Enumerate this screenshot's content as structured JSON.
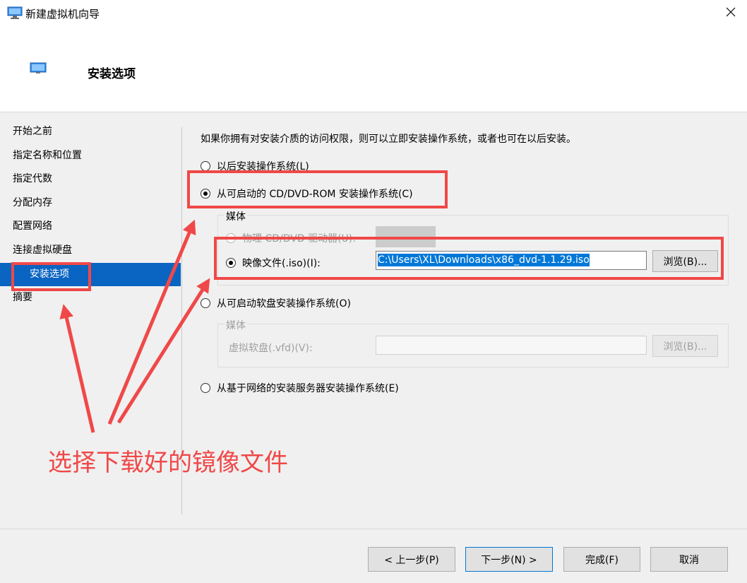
{
  "window": {
    "title": "新建虚拟机向导"
  },
  "header": {
    "title": "安装选项"
  },
  "sidebar": {
    "items": [
      {
        "label": "开始之前"
      },
      {
        "label": "指定名称和位置"
      },
      {
        "label": "指定代数"
      },
      {
        "label": "分配内存"
      },
      {
        "label": "配置网络"
      },
      {
        "label": "连接虚拟硬盘"
      },
      {
        "label": "安装选项"
      },
      {
        "label": "摘要"
      }
    ]
  },
  "main": {
    "intro": "如果你拥有对安装介质的访问权限，则可以立即安装操作系统，或者也可在以后安装。",
    "opt_later": "以后安装操作系统(L)",
    "opt_cd": "从可启动的 CD/DVD-ROM 安装操作系统(C)",
    "cd_group_label": "媒体",
    "opt_physical": "物理 CD/DVD 驱动器(U):",
    "opt_iso": "映像文件(.iso)(I):",
    "iso_path": "C:\\Users\\XL\\Downloads\\x86_dvd-1.1.29.iso",
    "browse_label": "浏览(B)...",
    "opt_floppy": "从可启动软盘安装操作系统(O)",
    "floppy_group_label": "媒体",
    "floppy_label": "虚拟软盘(.vfd)(V):",
    "floppy_value": "",
    "browse2_label": "浏览(B)...",
    "opt_network": "从基于网络的安装服务器安装操作系统(E)"
  },
  "footer": {
    "prev": "< 上一步(P)",
    "next": "下一步(N) >",
    "finish": "完成(F)",
    "cancel": "取消"
  },
  "annotation": {
    "text": "选择下载好的镜像文件",
    "color": "#f04848"
  },
  "colors": {
    "accent": "#0a64c2",
    "highlight": "#f04848"
  }
}
